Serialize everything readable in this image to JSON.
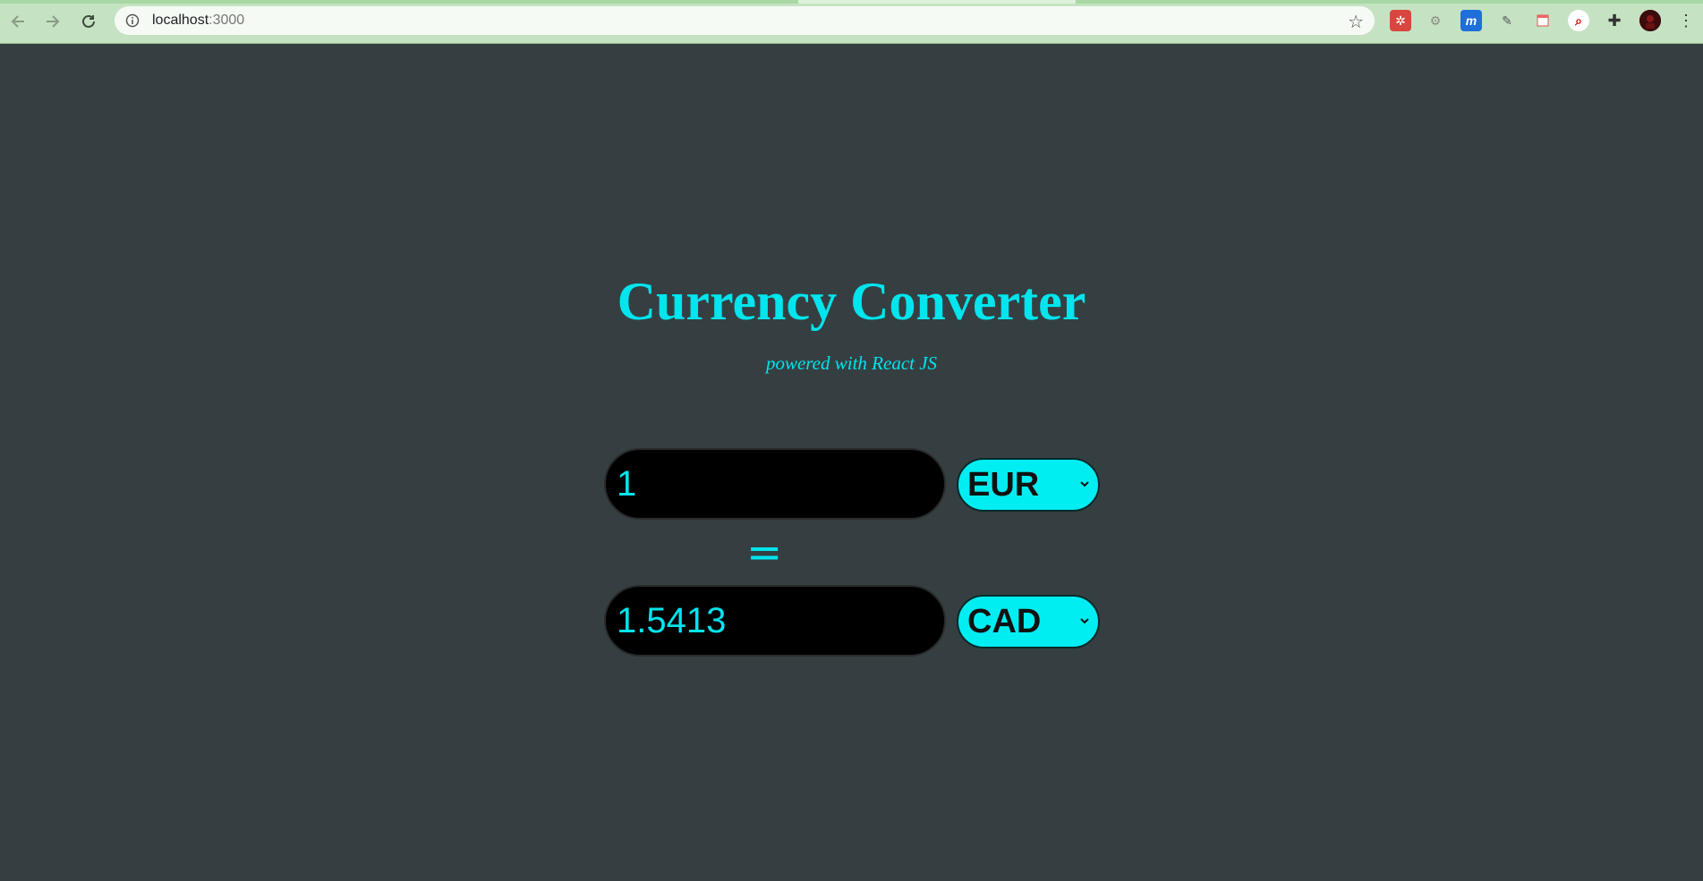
{
  "browser": {
    "url_host": "localhost",
    "url_port": ":3000",
    "extensions": [
      "puzzle-red-icon",
      "gear-ext-icon",
      "m-ext-icon",
      "eyedropper-icon",
      "notes-icon",
      "search-ext-icon",
      "extensions-icon",
      "profile-avatar"
    ],
    "accent_color": "#c5e3c2"
  },
  "page": {
    "title": "Currency Converter",
    "subtitle": "powered with React JS",
    "equals_symbol": "=",
    "accent_color": "#00e5ee",
    "background_color": "#353f41"
  },
  "converter": {
    "from": {
      "amount": "1",
      "currency": "EUR"
    },
    "to": {
      "amount": "1.5413",
      "currency": "CAD"
    }
  }
}
